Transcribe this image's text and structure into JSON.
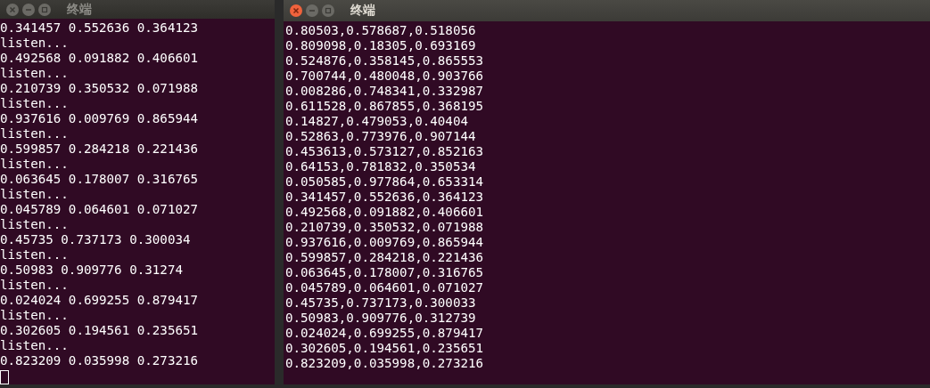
{
  "windows": [
    {
      "title": "终端",
      "active": false,
      "lines": [
        "0.341457 0.552636 0.364123",
        "listen...",
        "0.492568 0.091882 0.406601",
        "listen...",
        "0.210739 0.350532 0.071988",
        "listen...",
        "0.937616 0.009769 0.865944",
        "listen...",
        "0.599857 0.284218 0.221436",
        "listen...",
        "0.063645 0.178007 0.316765",
        "listen...",
        "0.045789 0.064601 0.071027",
        "listen...",
        "0.45735 0.737173 0.300034",
        "listen...",
        "0.50983 0.909776 0.31274",
        "listen...",
        "0.024024 0.699255 0.879417",
        "listen...",
        "0.302605 0.194561 0.235651",
        "listen...",
        "0.823209 0.035998 0.273216"
      ],
      "cursor": true
    },
    {
      "title": "终端",
      "active": true,
      "lines": [
        "0.80503,0.578687,0.518056",
        "0.809098,0.18305,0.693169",
        "0.524876,0.358145,0.865553",
        "0.700744,0.480048,0.903766",
        "0.008286,0.748341,0.332987",
        "0.611528,0.867855,0.368195",
        "0.14827,0.479053,0.40404",
        "0.52863,0.773976,0.907144",
        "0.453613,0.573127,0.852163",
        "0.64153,0.781832,0.350534",
        "0.050585,0.977864,0.653314",
        "0.341457,0.552636,0.364123",
        "0.492568,0.091882,0.406601",
        "0.210739,0.350532,0.071988",
        "0.937616,0.009769,0.865944",
        "0.599857,0.284218,0.221436",
        "0.063645,0.178007,0.316765",
        "0.045789,0.064601,0.071027",
        "0.45735,0.737173,0.300033",
        "0.50983,0.909776,0.312739",
        "0.024024,0.699255,0.879417",
        "0.302605,0.194561,0.235651",
        "0.823209,0.035998,0.273216"
      ],
      "cursor": false
    }
  ]
}
